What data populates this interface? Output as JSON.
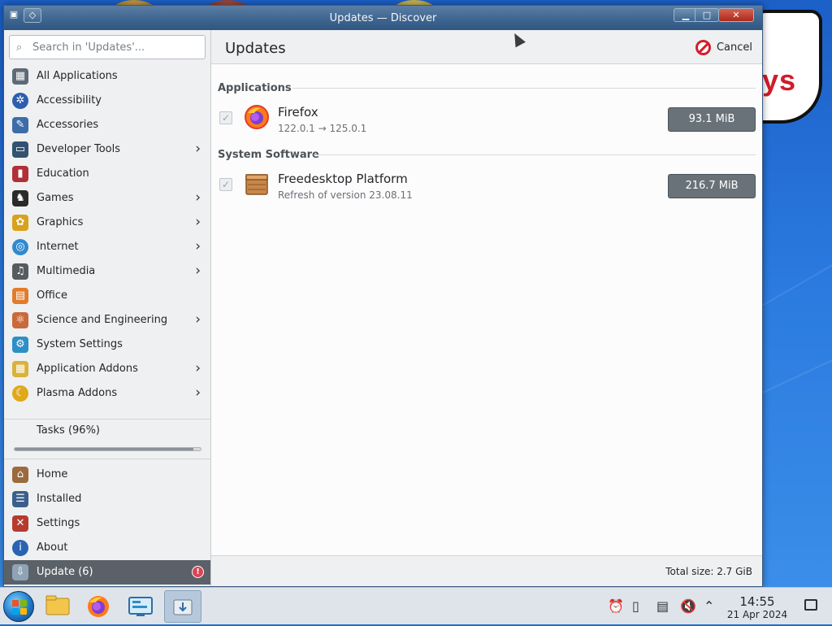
{
  "window": {
    "title": "Updates — Discover"
  },
  "search": {
    "placeholder": "Search in 'Updates'..."
  },
  "sidebar": {
    "categories": [
      {
        "label": "All Applications",
        "icon": "grid-icon",
        "color": "#5e6a75",
        "has_children": false
      },
      {
        "label": "Accessibility",
        "icon": "accessibility-icon",
        "color": "#2b5fae",
        "has_children": false
      },
      {
        "label": "Accessories",
        "icon": "accessories-icon",
        "color": "#3e6ca8",
        "has_children": false
      },
      {
        "label": "Developer Tools",
        "icon": "developer-tools-icon",
        "color": "#33526f",
        "has_children": true
      },
      {
        "label": "Education",
        "icon": "education-icon",
        "color": "#b03038",
        "has_children": false
      },
      {
        "label": "Games",
        "icon": "games-icon",
        "color": "#2a2a2a",
        "has_children": true
      },
      {
        "label": "Graphics",
        "icon": "graphics-icon",
        "color": "#d8a21e",
        "has_children": true
      },
      {
        "label": "Internet",
        "icon": "internet-icon",
        "color": "#2f8ad0",
        "has_children": true
      },
      {
        "label": "Multimedia",
        "icon": "multimedia-icon",
        "color": "#555b61",
        "has_children": true
      },
      {
        "label": "Office",
        "icon": "office-icon",
        "color": "#e27c2b",
        "has_children": false
      },
      {
        "label": "Science and Engineering",
        "icon": "science-icon",
        "color": "#c96a3a",
        "has_children": true
      },
      {
        "label": "System Settings",
        "icon": "system-settings-icon",
        "color": "#2d8fc7",
        "has_children": false
      },
      {
        "label": "Application Addons",
        "icon": "application-addons-icon",
        "color": "#d9b23c",
        "has_children": true
      },
      {
        "label": "Plasma Addons",
        "icon": "plasma-addons-icon",
        "color": "#e0a91a",
        "has_children": true
      }
    ],
    "tasks": {
      "label": "Tasks (96%)",
      "progress": 0.96
    },
    "bottom_items": [
      {
        "label": "Home",
        "icon": "home-icon",
        "color": "#9b6a3e"
      },
      {
        "label": "Installed",
        "icon": "installed-icon",
        "color": "#3b5f8c"
      },
      {
        "label": "Settings",
        "icon": "settings-icon",
        "color": "#b53b2e"
      },
      {
        "label": "About",
        "icon": "about-icon",
        "color": "#2a63b3"
      }
    ],
    "update_item": {
      "label": "Update (6)",
      "icon": "update-icon",
      "badge": "!"
    }
  },
  "main": {
    "title": "Updates",
    "cancel_label": "Cancel",
    "sections": [
      {
        "title": "Applications",
        "items": [
          {
            "name": "Firefox",
            "version": "122.0.1 → 125.0.1",
            "size": "93.1 MiB",
            "icon": "firefox-icon",
            "checked": true
          }
        ]
      },
      {
        "title": "System Software",
        "items": [
          {
            "name": "Freedesktop Platform",
            "version": "Refresh of version 23.08.11",
            "size": "216.7 MiB",
            "icon": "package-icon",
            "checked": true
          }
        ]
      }
    ],
    "total_size": "Total size: 2.7 GiB"
  },
  "taskbar": {
    "apps": [
      {
        "name": "file-manager-icon",
        "active": false
      },
      {
        "name": "firefox-icon",
        "active": false
      },
      {
        "name": "system-settings-icon",
        "active": false
      },
      {
        "name": "discover-icon",
        "active": true
      }
    ],
    "clock_time": "14:55",
    "clock_date": "21 Apr 2024"
  },
  "desktop": {
    "bubble_text": "ys"
  },
  "colors": {
    "accent": "#3f6690",
    "selection": "#5a6168",
    "cancel_red": "#d21f2b",
    "size_bar": "#6a7279"
  }
}
